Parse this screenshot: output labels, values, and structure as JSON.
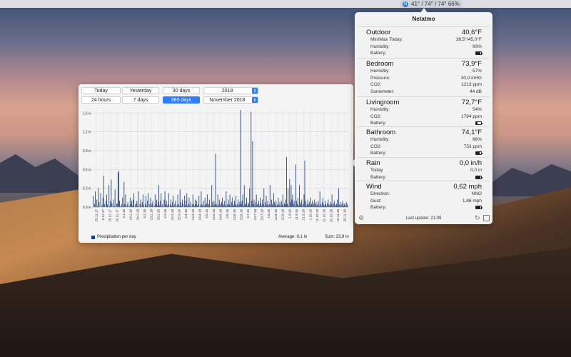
{
  "menubar": {
    "status_text": "41° / 74° / 74° 66%"
  },
  "chart_window": {
    "buttons_row1": [
      "Today",
      "Yesterday",
      "30 days"
    ],
    "buttons_row2": [
      "24 hours",
      "7 days",
      "365 days"
    ],
    "selected_button": "365 days",
    "year_select": "2018",
    "month_select": "November 2018",
    "legend": "Precipitation per day",
    "average": "Average: 0,1  in",
    "sum": "Sum: 23,9  in"
  },
  "chart_data": {
    "type": "bar",
    "ylim": [
      0,
      1.55
    ],
    "yticks": [
      "0.0 in",
      "0.3 in",
      "0.6 in",
      "0.9 in",
      "1.2 in",
      "1.5 in"
    ],
    "ytick_values": [
      0,
      0.3,
      0.6,
      0.9,
      1.2,
      1.5
    ],
    "xticks": [
      "25.11.17",
      "5.12.17",
      "15.12.17",
      "25.12.17",
      "4.1.18",
      "14.1.18",
      "24.1.18",
      "3.2.18",
      "13.2.18",
      "23.2.18",
      "5.3.18",
      "15.3.18",
      "25.3.18",
      "4.4.18",
      "14.4.18",
      "24.4.18",
      "4.5.18",
      "14.5.18",
      "24.5.18",
      "3.6.18",
      "13.6.18",
      "23.6.18",
      "3.7.18",
      "13.7.18",
      "23.7.18",
      "2.8.18",
      "12.8.18",
      "22.8.18",
      "1.9.18",
      "11.9.18",
      "21.9.18",
      "1.10.18",
      "11.10.18",
      "21.10.18",
      "31.10.18",
      "10.11.18",
      "20.11.18"
    ],
    "series": [
      {
        "name": "Precipitation per day",
        "color": "#1f3f7a",
        "values": [
          0.18,
          0,
          0.05,
          0.25,
          0,
          0.12,
          0.02,
          0.3,
          0.08,
          0,
          0.22,
          0,
          0.03,
          0.15,
          0.5,
          0.05,
          0,
          0.1,
          0.2,
          0.04,
          0,
          0.35,
          0.02,
          0.1,
          0.44,
          0.06,
          0,
          0.12,
          0.02,
          0.28,
          0,
          0.05,
          0.06,
          0.55,
          0.58,
          0.1,
          0.02,
          0,
          0.05,
          0.15,
          0.02,
          0.4,
          0.05,
          0.2,
          0,
          0.04,
          0.08,
          0,
          0.02,
          0.15,
          0.05,
          0.1,
          0.02,
          0.12,
          0.22,
          0,
          0.04,
          0.06,
          0.1,
          0.02,
          0.25,
          0,
          0.05,
          0.12,
          0.02,
          0.08,
          0.2,
          0.03,
          0,
          0.05,
          0.18,
          0.02,
          0.1,
          0.22,
          0,
          0.05,
          0.15,
          0.02,
          0.06,
          0.1,
          0,
          0.02,
          0.2,
          0.05,
          0.12,
          0.02,
          0.08,
          0.35,
          0.03,
          0.1,
          0.22,
          0.02,
          0.05,
          0,
          0.12,
          0.25,
          0.04,
          0.1,
          0.02,
          0.05,
          0.22,
          0,
          0.04,
          0.12,
          0.02,
          0.08,
          0.18,
          0.02,
          0.05,
          0.1,
          0,
          0.03,
          0.2,
          0.05,
          0.02,
          0.28,
          0.08,
          0.02,
          0.12,
          0.05,
          0,
          0.18,
          0.03,
          0.1,
          0.22,
          0.02,
          0.05,
          0.15,
          0.02,
          0.08,
          0,
          0.04,
          0.2,
          0.05,
          0.02,
          0.12,
          0.04,
          0.1,
          0.02,
          0.05,
          0.18,
          0,
          0.03,
          0.25,
          0.05,
          0.02,
          0.1,
          0.02,
          0.15,
          0.04,
          0.06,
          0.2,
          0.02,
          0.05,
          0.12,
          0,
          0.03,
          0.35,
          0.08,
          0.02,
          0.1,
          0.04,
          0.85,
          0.05,
          0.02,
          0.2,
          0.03,
          0.12,
          0.05,
          0.02,
          0.08,
          0.15,
          0.02,
          0.05,
          0.1,
          0.03,
          0.25,
          0.02,
          0.05,
          0.12,
          0.04,
          0.2,
          0.02,
          0.08,
          0.15,
          0.05,
          0.02,
          0.1,
          0.04,
          0.18,
          0.02,
          0.05,
          0.12,
          0.03,
          0.08,
          1.55,
          0.05,
          0.1,
          0.2,
          0.02,
          0.35,
          0.04,
          0.06,
          0.15,
          0.02,
          0.08,
          0.05,
          0.3,
          0.02,
          1.52,
          0.1,
          1.05,
          0.05,
          0.12,
          0.02,
          0.08,
          0.2,
          0.04,
          0.05,
          0.1,
          0.02,
          0.15,
          0.06,
          0.02,
          0.12,
          0.05,
          0.3,
          0.02,
          0.08,
          0.18,
          0.04,
          0.1,
          0.02,
          0.05,
          0.35,
          0.03,
          0.12,
          0.05,
          0.02,
          0.22,
          0.08,
          0.04,
          0.1,
          0.02,
          0.05,
          0.15,
          0.03,
          0.08,
          0.02,
          0.1,
          0.05,
          0.2,
          0.02,
          0.06,
          0.12,
          0.04,
          0.8,
          0.05,
          0.3,
          0.02,
          0.45,
          0.08,
          0.35,
          0.12,
          0.2,
          0.05,
          0.1,
          0.02,
          0.68,
          0.1,
          0.05,
          0.15,
          0.02,
          0.35,
          0.04,
          0.08,
          0.12,
          0.02,
          0.05,
          0.2,
          0.74,
          0.1,
          0.02,
          0.05,
          0.12,
          0.04,
          0.08,
          0.02,
          0.15,
          0.05,
          0.1,
          0.02,
          0.06,
          0.12,
          0.04,
          0.08,
          0.02,
          0.05,
          0.1,
          0.02,
          0.25,
          0.05,
          0.02,
          0.08,
          0.15,
          0.04,
          0.02,
          0.1,
          0.05,
          0.02,
          0.06,
          0.12,
          0.04,
          0.02,
          0.08,
          0.05,
          0.2,
          0.02,
          0.06,
          0.1,
          0.04,
          0.02,
          0.05,
          0.12,
          0.02,
          0.3,
          0.04,
          0.08,
          0.02,
          0.05,
          0.1,
          0.02,
          0.06,
          0.04,
          0.02,
          0.08,
          0.05,
          0.02
        ]
      }
    ]
  },
  "popover": {
    "title": "Netatmo",
    "sections": [
      {
        "name": "Outdoor",
        "value": "40,6°F",
        "rows": [
          {
            "label": "Min/Max Today:",
            "value": "38,5°/45,0°F"
          },
          {
            "label": "Humidity:",
            "value": "93%"
          },
          {
            "label": "Battery:",
            "battery": 0.85
          }
        ]
      },
      {
        "name": "Bedroom",
        "value": "73,9°F",
        "rows": [
          {
            "label": "Humidity:",
            "value": "57%"
          },
          {
            "label": "Pressure:",
            "value": "30,0 inHG"
          },
          {
            "label": "CO2:",
            "value": "1213 ppm"
          },
          {
            "label": "Sonometer:",
            "value": "44 dB"
          }
        ]
      },
      {
        "name": "Livingroom",
        "value": "72,7°F",
        "rows": [
          {
            "label": "Humidity:",
            "value": "54%"
          },
          {
            "label": "CO2:",
            "value": "1794 ppm"
          },
          {
            "label": "Battery:",
            "battery": 0.35
          }
        ]
      },
      {
        "name": "Bathroom",
        "value": "74,1°F",
        "rows": [
          {
            "label": "Humidity:",
            "value": "66%"
          },
          {
            "label": "CO2:",
            "value": "753 ppm"
          },
          {
            "label": "Battery:",
            "battery": 0.75
          }
        ]
      },
      {
        "name": "Rain",
        "value": "0,0 in/h",
        "rows": [
          {
            "label": "Today",
            "value": "0,0 in"
          },
          {
            "label": "Battery:",
            "battery": 0.85
          }
        ]
      },
      {
        "name": "Wind",
        "value": "0,62 mph",
        "rows": [
          {
            "label": "Direction:",
            "value": "NNO"
          },
          {
            "label": "Gust:",
            "value": "1,86 mph"
          },
          {
            "label": "Battery:",
            "battery": 0.85
          }
        ]
      }
    ],
    "footer": "Last update: 21:09"
  }
}
